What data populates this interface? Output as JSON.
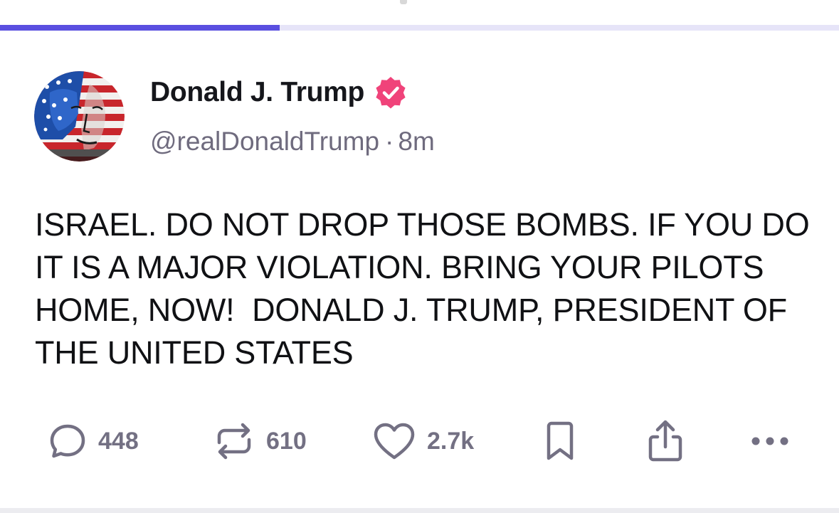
{
  "progress": {
    "fraction": 0.333,
    "fill_color": "#5a4fe0",
    "track_color": "#e6e4f8"
  },
  "post": {
    "author": {
      "display_name": "Donald J. Trump",
      "handle": "@realDonaldTrump",
      "verified_icon": "verified-badge-icon",
      "verified_color": "#f0437a"
    },
    "timestamp": "8m",
    "separator": "·",
    "text": "ISRAEL. DO NOT DROP THOSE BOMBS. IF YOU DO IT IS A MAJOR VIOLATION. BRING YOUR PILOTS HOME, NOW!  DONALD J. TRUMP, PRESIDENT OF THE UNITED STATES"
  },
  "actions": {
    "reply": {
      "icon": "reply-bubble-icon",
      "count": "448"
    },
    "repost": {
      "icon": "repost-icon",
      "count": "610"
    },
    "like": {
      "icon": "heart-icon",
      "count": "2.7k"
    },
    "bookmark": {
      "icon": "bookmark-icon"
    },
    "share": {
      "icon": "share-icon"
    },
    "more": {
      "icon": "more-dots-icon"
    }
  }
}
